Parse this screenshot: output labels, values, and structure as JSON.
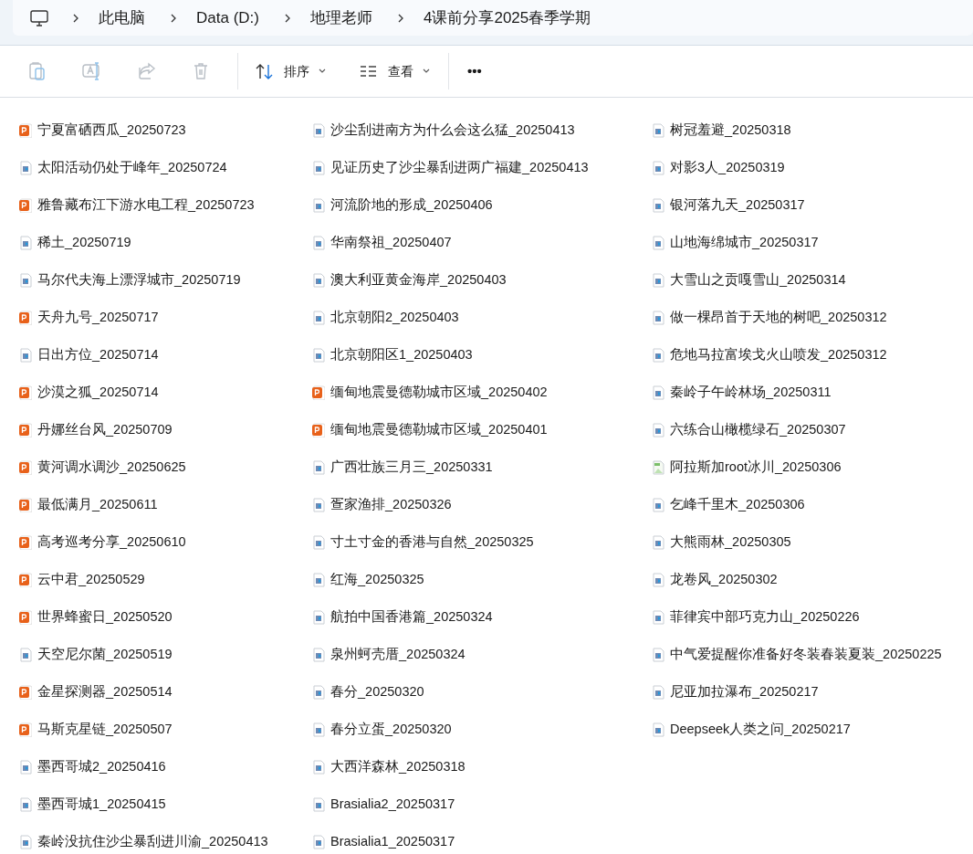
{
  "breadcrumb": [
    "此电脑",
    "Data (D:)",
    "地理老师",
    "4课前分享2025春季学期"
  ],
  "toolbar": {
    "actions": [
      {
        "kind": "paste",
        "disabled": true
      },
      {
        "kind": "rename",
        "disabled": true
      },
      {
        "kind": "share",
        "disabled": true
      },
      {
        "kind": "delete",
        "disabled": true
      }
    ],
    "menus": [
      {
        "kind": "sort",
        "label": "排序"
      },
      {
        "kind": "view",
        "label": "查看"
      }
    ],
    "more": "•••"
  },
  "files": [
    [
      {
        "name": "宁夏富硒西瓜_20250723",
        "kind": "ppt"
      },
      {
        "name": "太阳活动仍处于峰年_20250724",
        "kind": "video"
      },
      {
        "name": "雅鲁藏布江下游水电工程_20250723",
        "kind": "ppt"
      },
      {
        "name": "稀土_20250719",
        "kind": "video"
      },
      {
        "name": "马尔代夫海上漂浮城市_20250719",
        "kind": "video"
      },
      {
        "name": "天舟九号_20250717",
        "kind": "ppt"
      },
      {
        "name": "日出方位_20250714",
        "kind": "video"
      },
      {
        "name": "沙漠之狐_20250714",
        "kind": "ppt"
      },
      {
        "name": "丹娜丝台风_20250709",
        "kind": "ppt"
      },
      {
        "name": "黄河调水调沙_20250625",
        "kind": "ppt"
      },
      {
        "name": "最低满月_20250611",
        "kind": "ppt"
      },
      {
        "name": "高考巡考分享_20250610",
        "kind": "ppt"
      },
      {
        "name": "云中君_20250529",
        "kind": "ppt"
      },
      {
        "name": "世界蜂蜜日_20250520",
        "kind": "ppt"
      },
      {
        "name": "天空尼尔菌_20250519",
        "kind": "video"
      },
      {
        "name": "金星探测器_20250514",
        "kind": "ppt"
      },
      {
        "name": "马斯克星链_20250507",
        "kind": "ppt"
      },
      {
        "name": "墨西哥城2_20250416",
        "kind": "video"
      },
      {
        "name": "墨西哥城1_20250415",
        "kind": "video"
      },
      {
        "name": "秦岭没抗住沙尘暴刮进川渝_20250413",
        "kind": "video"
      }
    ],
    [
      {
        "name": "沙尘刮进南方为什么会这么猛_20250413",
        "kind": "video"
      },
      {
        "name": "见证历史了沙尘暴刮进两广福建_20250413",
        "kind": "video"
      },
      {
        "name": "河流阶地的形成_20250406",
        "kind": "video"
      },
      {
        "name": "华南祭祖_20250407",
        "kind": "video"
      },
      {
        "name": "澳大利亚黄金海岸_20250403",
        "kind": "video"
      },
      {
        "name": "北京朝阳2_20250403",
        "kind": "video"
      },
      {
        "name": "北京朝阳区1_20250403",
        "kind": "video"
      },
      {
        "name": "缅甸地震曼德勒城市区域_20250402",
        "kind": "ppt"
      },
      {
        "name": "缅甸地震曼德勒城市区域_20250401",
        "kind": "ppt"
      },
      {
        "name": "广西壮族三月三_20250331",
        "kind": "video"
      },
      {
        "name": "疍家渔排_20250326",
        "kind": "video"
      },
      {
        "name": "寸土寸金的香港与自然_20250325",
        "kind": "video"
      },
      {
        "name": "红海_20250325",
        "kind": "video"
      },
      {
        "name": "航拍中国香港篇_20250324",
        "kind": "video"
      },
      {
        "name": "泉州蚵壳厝_20250324",
        "kind": "video"
      },
      {
        "name": "春分_20250320",
        "kind": "video"
      },
      {
        "name": "春分立蛋_20250320",
        "kind": "video"
      },
      {
        "name": "大西洋森林_20250318",
        "kind": "video"
      },
      {
        "name": "Brasialia2_20250317",
        "kind": "video"
      },
      {
        "name": "Brasialia1_20250317",
        "kind": "video"
      }
    ],
    [
      {
        "name": "树冠羞避_20250318",
        "kind": "video"
      },
      {
        "name": "对影3人_20250319",
        "kind": "video"
      },
      {
        "name": "银河落九天_20250317",
        "kind": "video"
      },
      {
        "name": "山地海绵城市_20250317",
        "kind": "video"
      },
      {
        "name": "大雪山之贡嘎雪山_20250314",
        "kind": "video"
      },
      {
        "name": "做一棵昂首于天地的树吧_20250312",
        "kind": "video"
      },
      {
        "name": "危地马拉富埃戈火山喷发_20250312",
        "kind": "video"
      },
      {
        "name": "秦岭子午岭林场_20250311",
        "kind": "video"
      },
      {
        "name": "六练合山橄榄绿石_20250307",
        "kind": "video"
      },
      {
        "name": "阿拉斯加root冰川_20250306",
        "kind": "image"
      },
      {
        "name": "乞峰千里木_20250306",
        "kind": "video"
      },
      {
        "name": "大熊雨林_20250305",
        "kind": "video"
      },
      {
        "name": "龙卷风_20250302",
        "kind": "video"
      },
      {
        "name": "菲律宾中部巧克力山_20250226",
        "kind": "video"
      },
      {
        "name": "中气爱提醒你准备好冬装春装夏装_20250225",
        "kind": "video"
      },
      {
        "name": "尼亚加拉瀑布_20250217",
        "kind": "video"
      },
      {
        "name": "Deepseek人类之问_20250217",
        "kind": "video"
      }
    ]
  ]
}
